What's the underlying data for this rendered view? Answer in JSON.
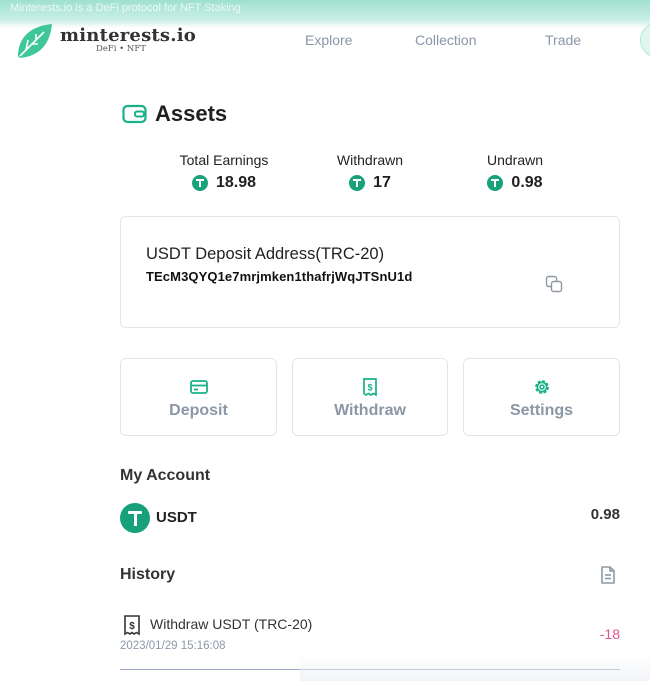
{
  "top_notice": "Minterests.io is a DeFi protocol for NFT Staking",
  "brand": {
    "name": "minterests.io",
    "tagline": "DeFi • NFT"
  },
  "nav": {
    "items": [
      "Explore",
      "Collection",
      "Trade"
    ]
  },
  "assets": {
    "title": "Assets",
    "stats": [
      {
        "label": "Total Earnings",
        "value": "18.98"
      },
      {
        "label": "Withdrawn",
        "value": "17"
      },
      {
        "label": "Undrawn",
        "value": "0.98"
      }
    ]
  },
  "deposit": {
    "title": "USDT Deposit Address(TRC-20)",
    "address": "TEcM3QYQ1e7mrjmken1thafrjWqJTSnU1d"
  },
  "actions": [
    {
      "label": "Deposit",
      "icon": "wallet-card-icon"
    },
    {
      "label": "Withdraw",
      "icon": "bill-icon"
    },
    {
      "label": "Settings",
      "icon": "gear-icon"
    }
  ],
  "account": {
    "title": "My Account",
    "coin": "USDT",
    "balance": "0.98"
  },
  "history": {
    "title": "History",
    "items": [
      {
        "desc": "Withdraw USDT (TRC-20)",
        "time": "2023/01/29 15:16:08",
        "amount": "-18"
      }
    ]
  },
  "colors": {
    "accent": "#19a17a",
    "muted": "#8b97a6",
    "negative": "#e0558c"
  }
}
